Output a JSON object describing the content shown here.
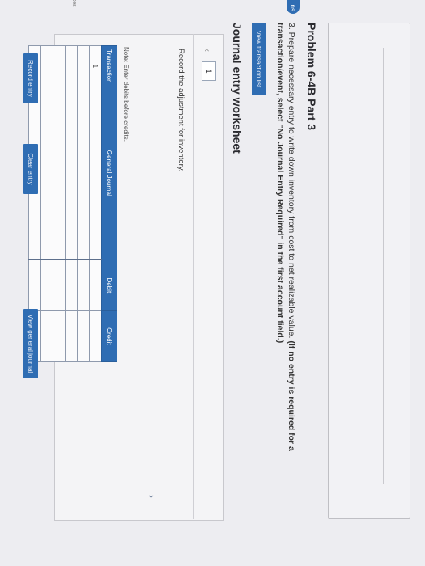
{
  "problem": {
    "title": "Problem 6-4B Part 3",
    "instruction_main": "3. Prepare necessary entry to write down inventory from cost to net realizable value.",
    "instruction_bold": "(If no entry is required for a transaction/event, select \"No Journal Entry Required\" in the first account field.)"
  },
  "side": {
    "tab_label": "ns",
    "label": "ences"
  },
  "buttons": {
    "view_transaction_list": "View transaction list",
    "record_entry": "Record entry",
    "clear_entry": "Clear entry",
    "view_general_journal": "View general journal"
  },
  "worksheet": {
    "title": "Journal entry worksheet",
    "page": "1",
    "prompt": "Record the adjustment for inventory.",
    "note": "Note: Enter debits before credits."
  },
  "journal": {
    "headers": [
      "Transaction",
      "General Journal",
      "Debit",
      "Credit"
    ],
    "rows": [
      {
        "transaction": "1",
        "account": "",
        "debit": "",
        "credit": ""
      },
      {
        "transaction": "",
        "account": "",
        "debit": "",
        "credit": ""
      },
      {
        "transaction": "",
        "account": "",
        "debit": "",
        "credit": ""
      },
      {
        "transaction": "",
        "account": "",
        "debit": "",
        "credit": ""
      },
      {
        "transaction": "",
        "account": "",
        "debit": "",
        "credit": ""
      },
      {
        "transaction": "",
        "account": "",
        "debit": "",
        "credit": ""
      }
    ]
  },
  "colors": {
    "accent": "#2f6db3",
    "page_bg": "#ededf1"
  }
}
